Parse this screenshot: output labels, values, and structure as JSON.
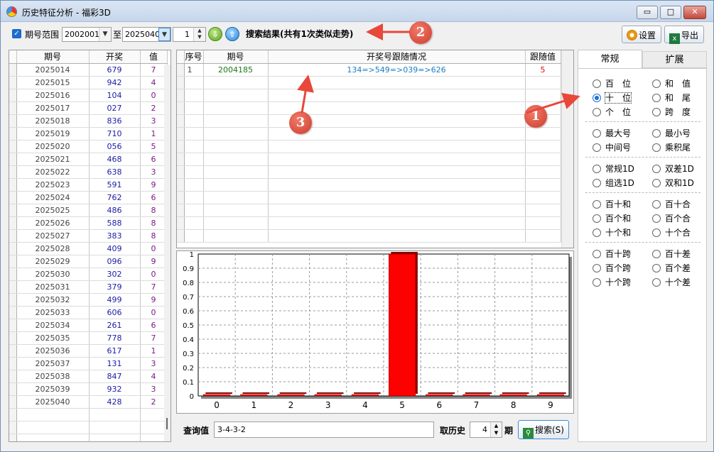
{
  "window": {
    "title": "历史特征分析 - 福彩3D",
    "min_label": "▭",
    "max_label": "□",
    "close_label": "✕"
  },
  "toolbar": {
    "range_check": "✓",
    "range_label": "期号范围",
    "from": "2002001",
    "to_label": "至",
    "to": "2025040",
    "count": "1",
    "result_text": "搜索结果(共有1次类似走势)",
    "settings_label": "设置",
    "export_label": "导出"
  },
  "left_table": {
    "headers": [
      "期号",
      "开奖",
      "值"
    ],
    "rows": [
      [
        "2025014",
        "679",
        "7"
      ],
      [
        "2025015",
        "942",
        "4"
      ],
      [
        "2025016",
        "104",
        "0"
      ],
      [
        "2025017",
        "027",
        "2"
      ],
      [
        "2025018",
        "836",
        "3"
      ],
      [
        "2025019",
        "710",
        "1"
      ],
      [
        "2025020",
        "056",
        "5"
      ],
      [
        "2025021",
        "468",
        "6"
      ],
      [
        "2025022",
        "638",
        "3"
      ],
      [
        "2025023",
        "591",
        "9"
      ],
      [
        "2025024",
        "762",
        "6"
      ],
      [
        "2025025",
        "486",
        "8"
      ],
      [
        "2025026",
        "588",
        "8"
      ],
      [
        "2025027",
        "383",
        "8"
      ],
      [
        "2025028",
        "409",
        "0"
      ],
      [
        "2025029",
        "096",
        "9"
      ],
      [
        "2025030",
        "302",
        "0"
      ],
      [
        "2025031",
        "379",
        "7"
      ],
      [
        "2025032",
        "499",
        "9"
      ],
      [
        "2025033",
        "606",
        "0"
      ],
      [
        "2025034",
        "261",
        "6"
      ],
      [
        "2025035",
        "778",
        "7"
      ],
      [
        "2025036",
        "617",
        "1"
      ],
      [
        "2025037",
        "131",
        "3"
      ],
      [
        "2025038",
        "847",
        "4"
      ],
      [
        "2025039",
        "932",
        "3"
      ],
      [
        "2025040",
        "428",
        "2"
      ]
    ]
  },
  "result_table": {
    "headers": [
      "序号",
      "期号",
      "开奖号跟随情况",
      "跟随值"
    ],
    "rows": [
      [
        "1",
        "2004185",
        "134=>549=>039=>626",
        "5"
      ]
    ]
  },
  "tabs": [
    "常规",
    "扩展"
  ],
  "radios": [
    [
      "百　位",
      "和　值"
    ],
    [
      "十　位",
      "和　尾"
    ],
    [
      "个　位",
      "跨　度"
    ],
    [
      "最大号",
      "最小号"
    ],
    [
      "中间号",
      "乘积尾"
    ],
    [
      "常规1D",
      "双差1D"
    ],
    [
      "组选1D",
      "双和1D"
    ],
    [
      "百十和",
      "百十合"
    ],
    [
      "百个和",
      "百个合"
    ],
    [
      "十个和",
      "十个合"
    ],
    [
      "百十跨",
      "百十差"
    ],
    [
      "百个跨",
      "百个差"
    ],
    [
      "十个跨",
      "十个差"
    ]
  ],
  "selected_radio": "十　位",
  "query": {
    "label": "查询值",
    "value": "3-4-3-2",
    "history_label": "取历史",
    "history_value": "4",
    "period_label": "期",
    "search_label": "搜索(S)"
  },
  "annotations": [
    "1",
    "2",
    "3"
  ],
  "chart_data": {
    "type": "bar",
    "categories": [
      "0",
      "1",
      "2",
      "3",
      "4",
      "5",
      "6",
      "7",
      "8",
      "9"
    ],
    "values": [
      0,
      0,
      0,
      0,
      0,
      1,
      0,
      0,
      0,
      0
    ],
    "yticks": [
      "0",
      "0.1",
      "0.2",
      "0.3",
      "0.4",
      "0.5",
      "0.6",
      "0.7",
      "0.8",
      "0.9",
      "1"
    ],
    "ylim": [
      0,
      1
    ],
    "grid": true,
    "bar_color": "#ff0000"
  }
}
